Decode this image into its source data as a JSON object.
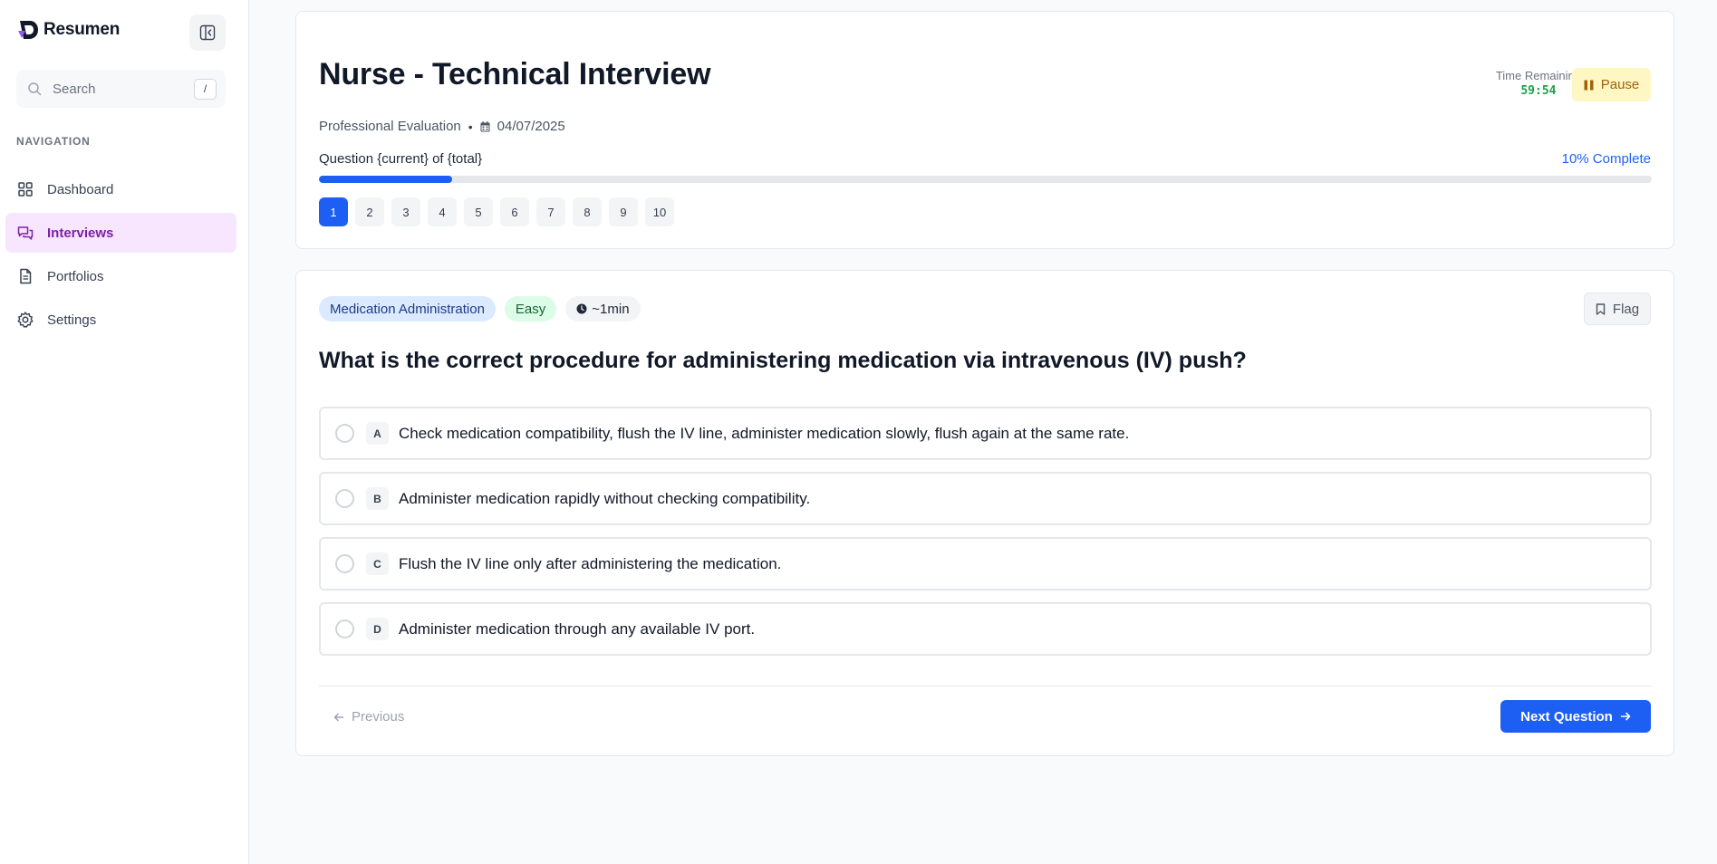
{
  "sidebar": {
    "brand": "Resumen",
    "search": {
      "placeholder": "Search",
      "shortcut": "/"
    },
    "nav_heading": "NAVIGATION",
    "items": [
      {
        "label": "Dashboard",
        "icon": "dashboard-icon"
      },
      {
        "label": "Interviews",
        "icon": "chat-icon",
        "active": true
      },
      {
        "label": "Portfolios",
        "icon": "document-icon"
      },
      {
        "label": "Settings",
        "icon": "gear-icon"
      }
    ]
  },
  "header": {
    "title": "Nurse - Technical Interview",
    "category": "Professional Evaluation",
    "separator": "•",
    "date": "04/07/2025",
    "timer_label": "Time Remaining",
    "timer_value": "59:54",
    "pause_label": "Pause",
    "question_label": "Question {current} of {total}",
    "progress_label": "10% Complete",
    "progress_fraction": 0.1,
    "question_numbers": [
      "1",
      "2",
      "3",
      "4",
      "5",
      "6",
      "7",
      "8",
      "9",
      "10"
    ],
    "current_question_index": 0
  },
  "question": {
    "topic": "Medication Administration",
    "difficulty": "Easy",
    "duration": "~1min",
    "flag_label": "Flag",
    "text": "What is the correct procedure for administering medication via intravenous (IV) push?",
    "options": [
      {
        "letter": "A",
        "text": "Check medication compatibility, flush the IV line, administer medication slowly, flush again at the same rate."
      },
      {
        "letter": "B",
        "text": "Administer medication rapidly without checking compatibility."
      },
      {
        "letter": "C",
        "text": "Flush the IV line only after administering the medication."
      },
      {
        "letter": "D",
        "text": "Administer medication through any available IV port."
      }
    ],
    "prev_label": "Previous",
    "next_label": "Next Question"
  },
  "colors": {
    "accent": "#1d5ff3",
    "active_nav_bg": "#f7e6fd",
    "active_nav_text": "#7e1fa8",
    "timer": "#16a34a",
    "pause_bg": "#fef6c3"
  }
}
